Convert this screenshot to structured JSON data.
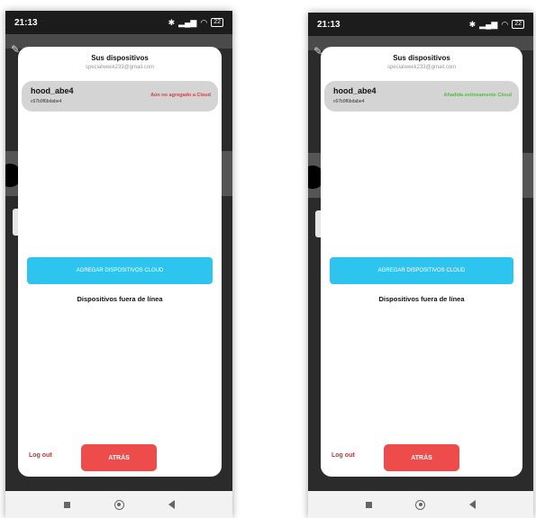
{
  "left_screen": {
    "status_time": "21:13",
    "battery": "22",
    "modal_title": "Sus dispositivos",
    "account_email": "specialweek233@gmail.com",
    "device": {
      "name": "hood_abe4",
      "id": "c67b9f6bdabe4",
      "status": "Aún no agregado a Cloud",
      "status_color": "#e23c3c"
    },
    "add_button": "AGREGAR DISPOSITIVOS CLOUD",
    "offline_title": "Dispositivos fuera de línea",
    "logout": "Log out",
    "back_button": "ATRÁS"
  },
  "right_screen": {
    "status_time": "21:13",
    "battery": "22",
    "modal_title": "Sus dispositivos",
    "account_email": "specialweek233@gmail.com",
    "device": {
      "name": "hood_abe4",
      "id": "c67b9f6bdabe4",
      "status": "Añadida exitosamente Cloud",
      "status_color": "#4fbf3a"
    },
    "add_button": "AGREGAR DISPOSITIVOS CLOUD",
    "offline_title": "Dispositivos fuera de línea",
    "logout": "Log out",
    "back_button": "ATRÁS"
  }
}
